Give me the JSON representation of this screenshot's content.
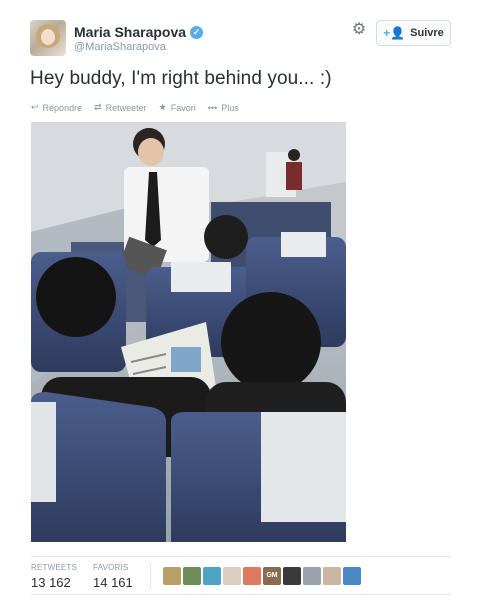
{
  "user": {
    "name": "Maria Sharapova",
    "handle": "@MariaSharapova",
    "verified": true
  },
  "follow_button": {
    "label": "Suivre"
  },
  "tweet": {
    "text": "Hey buddy, I'm right behind you... :)"
  },
  "actions": [
    {
      "label": "Répondre",
      "icon": "reply-icon"
    },
    {
      "label": "Retweeter",
      "icon": "retweet-icon"
    },
    {
      "label": "Favori",
      "icon": "star-icon"
    },
    {
      "label": "Plus",
      "icon": "more-dots-icon"
    }
  ],
  "stats": {
    "retweets_label": "RETWEETS",
    "retweets_count": "13 162",
    "favorites_label": "FAVORIS",
    "favorites_count": "14 161"
  },
  "favoriters": [
    {
      "color": "#b9a06a"
    },
    {
      "color": "#6b8e5a"
    },
    {
      "color": "#4fa3c7"
    },
    {
      "color": "#d9cfc3"
    },
    {
      "color": "#e07a5f"
    },
    {
      "color": "#8a6b4e"
    },
    {
      "color": "#3a3a3a"
    },
    {
      "color": "#9aa3ad"
    },
    {
      "color": "#c9b6a3"
    },
    {
      "color": "#4b87c5"
    }
  ],
  "favoriters_labels": {
    "gm_badge": "GM"
  },
  "colors": {
    "accent": "#55acee",
    "text": "#292f33",
    "muted": "#8899a6"
  }
}
